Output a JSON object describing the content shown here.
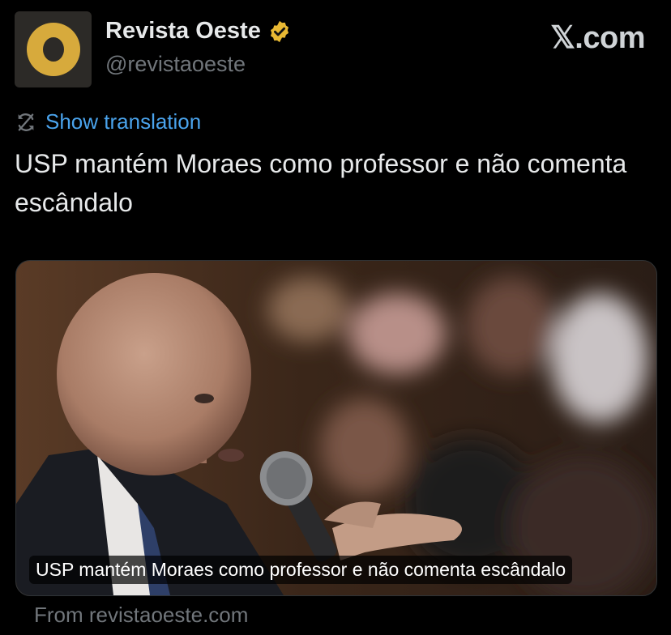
{
  "header": {
    "account_name": "Revista Oeste",
    "handle": "@revistaoeste",
    "brand": "𝕏.com"
  },
  "colors": {
    "link": "#4aa3ec",
    "verified_badge": "#e8b833",
    "avatar_ring": "#d7aa3c"
  },
  "icons": {
    "verified": "verified-badge-icon",
    "translate": "translate-icon"
  },
  "post": {
    "translate_label": "Show translation",
    "text": "USP mantém Moraes como professor e não comenta escândalo"
  },
  "card": {
    "caption": "USP mantém Moraes como professor e não comenta escândalo",
    "source": "From revistaoeste.com"
  }
}
